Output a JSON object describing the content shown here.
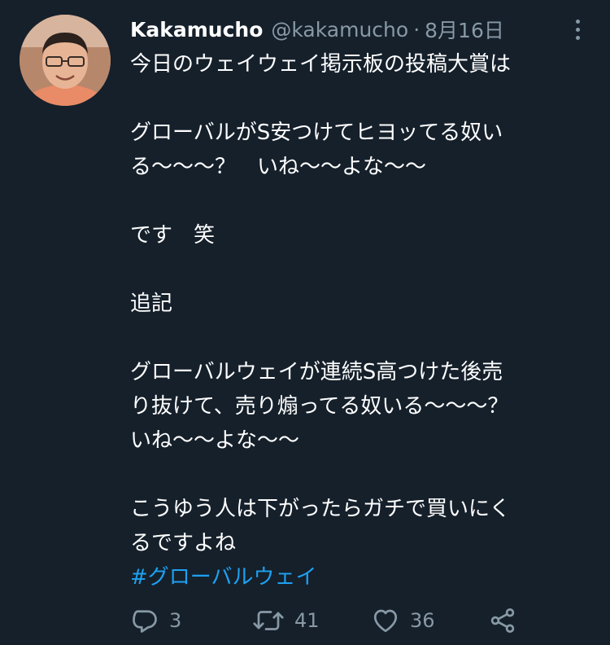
{
  "user": {
    "display_name": "Kakamucho",
    "handle": "@kakamucho",
    "separator": "·",
    "date": "8月16日"
  },
  "tweet": {
    "lines": [
      "今日のウェイウェイ掲示板の投稿大賞は",
      "",
      "グローバルがS安つけてヒヨッてる奴い",
      "る〜〜〜？　いね〜〜よな〜〜",
      "",
      "です　笑",
      "",
      "追記",
      "",
      "グローバルウェイが連続S高つけた後売",
      "り抜けて、売り煽ってる奴いる〜〜〜？",
      "いね〜〜よな〜〜",
      "",
      "こうゆう人は下がったらガチで買いにく",
      "るですよね"
    ],
    "hashtag": "#グローバルウェイ"
  },
  "actions": {
    "reply_count": "3",
    "retweet_count": "41",
    "like_count": "36"
  },
  "icons": {
    "reply": "reply-icon",
    "retweet": "retweet-icon",
    "like": "heart-icon",
    "share": "share-icon",
    "more": "more-icon"
  },
  "colors": {
    "background": "#15202b",
    "secondary_text": "#8899a6",
    "link": "#1da1f2"
  }
}
